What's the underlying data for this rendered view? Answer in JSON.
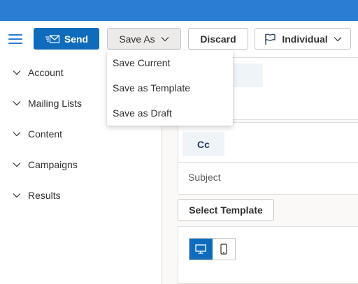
{
  "toolbar": {
    "send_label": "Send",
    "save_as_label": "Save As",
    "discard_label": "Discard",
    "individual_label": "Individual"
  },
  "save_as_menu": {
    "items": [
      {
        "label": "Save Current"
      },
      {
        "label": "Save as Template"
      },
      {
        "label": "Save as Draft"
      }
    ]
  },
  "sidebar": {
    "items": [
      {
        "label": "Account"
      },
      {
        "label": "Mailing Lists"
      },
      {
        "label": "Content"
      },
      {
        "label": "Campaigns"
      },
      {
        "label": "Results"
      }
    ]
  },
  "compose": {
    "cc_label": "Cc",
    "subject_label": "Subject",
    "select_template_label": "Select Template"
  },
  "colors": {
    "brand": "#2b7cd3",
    "primary_button": "#0f6cbd"
  },
  "icons": {
    "menu": "hamburger-icon",
    "send": "send-icon",
    "flag": "flag-icon",
    "desktop": "desktop-icon",
    "mobile": "mobile-icon"
  }
}
